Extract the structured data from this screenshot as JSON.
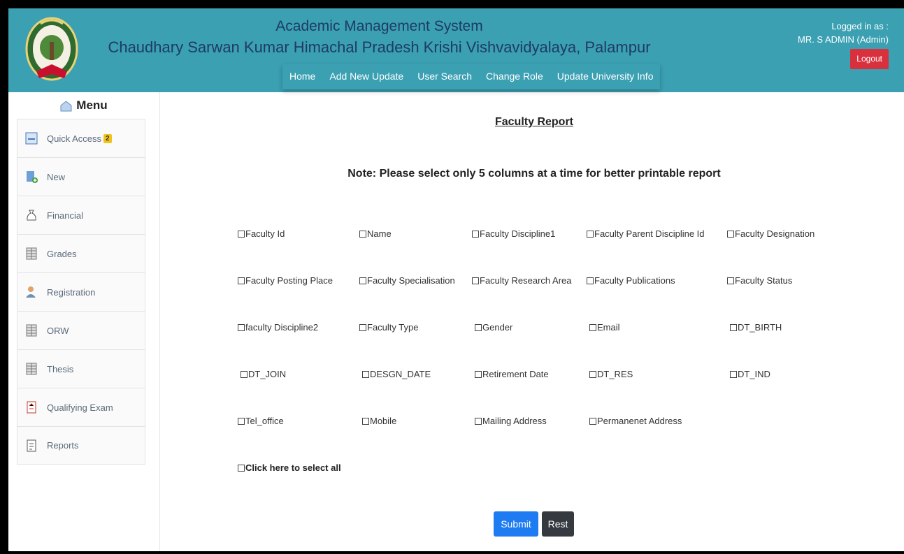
{
  "header": {
    "title": "Academic Management System",
    "subtitle": "Chaudhary Sarwan Kumar Himachal Pradesh Krishi Vishvavidyalaya, Palampur",
    "logged_in_label": "Logged in as :",
    "user": "MR. S ADMIN (Admin)",
    "logout_label": "Logout",
    "nav": [
      "Home",
      "Add New Update",
      "User Search",
      "Change Role",
      "Update University Info"
    ]
  },
  "sidebar": {
    "title": "Menu",
    "items": [
      {
        "label": "Quick Access",
        "icon": "quick-access-icon",
        "badge": "2"
      },
      {
        "label": "New",
        "icon": "new-document-icon"
      },
      {
        "label": "Financial",
        "icon": "money-bag-icon"
      },
      {
        "label": "Grades",
        "icon": "grid-sheet-icon"
      },
      {
        "label": "Registration",
        "icon": "user-icon"
      },
      {
        "label": "ORW",
        "icon": "grid-sheet-icon"
      },
      {
        "label": "Thesis",
        "icon": "grid-sheet-icon"
      },
      {
        "label": "Qualifying Exam",
        "icon": "exam-sheet-icon"
      },
      {
        "label": "Reports",
        "icon": "report-icon"
      }
    ]
  },
  "main": {
    "title": "Faculty Report",
    "note": "Note: Please select only 5 columns at a time for better printable report",
    "columns": [
      "Faculty Id",
      "Name",
      "Faculty Discipline1",
      "Faculty Parent Discipline Id",
      "Faculty Designation",
      "Faculty Posting Place",
      "Faculty Specialisation",
      "Faculty Research Area",
      "Faculty Publications",
      "Faculty Status",
      "faculty Discipline2",
      "Faculty Type",
      "Gender",
      "Email",
      "DT_BIRTH",
      "DT_JOIN",
      "DESGN_DATE",
      "Retirement Date",
      "DT_RES",
      "DT_IND",
      "Tel_office",
      "Mobile",
      "Mailing Address",
      "Permanenet Address"
    ],
    "select_all": "Click here to select all",
    "submit_label": "Submit",
    "reset_label": "Rest"
  },
  "colors": {
    "header_bg": "#3aa0b2",
    "title_text": "#1f3b66",
    "logout_bg": "#d9303e",
    "submit_bg": "#1e7bf2",
    "reset_bg": "#343a40",
    "badge_bg": "#f0c419"
  }
}
